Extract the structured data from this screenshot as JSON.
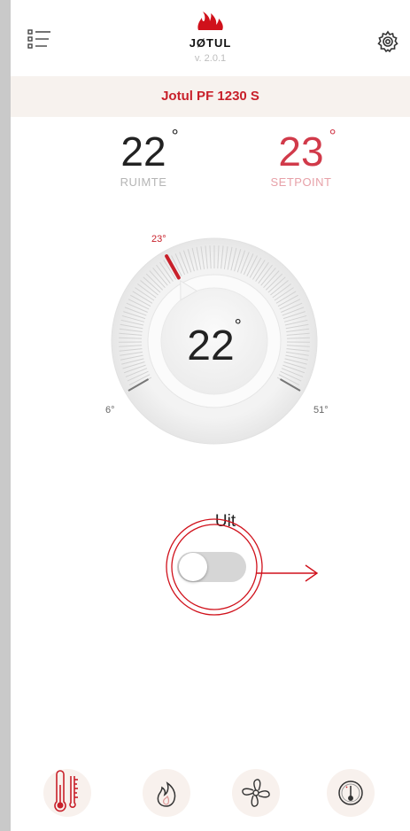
{
  "header": {
    "brand": "JØTUL",
    "version": "v. 2.0.1",
    "menu_icon": "list-menu-icon",
    "settings_icon": "gear-icon"
  },
  "device": {
    "name": "Jotul PF 1230 S"
  },
  "temperatures": {
    "room": {
      "value": "22",
      "label": "RUIMTE"
    },
    "setpoint": {
      "value": "23",
      "label": "SETPOINT"
    }
  },
  "dial": {
    "current": "22",
    "setpoint_marker": "23°",
    "min_label": "6°",
    "max_label": "51°",
    "min": 6,
    "max": 51,
    "setpoint": 23
  },
  "mode": {
    "label": "Uit",
    "toggle_on": false
  },
  "bottom_nav": [
    {
      "icon": "thermometer-icon",
      "active": true
    },
    {
      "icon": "flame-icon",
      "active": false
    },
    {
      "icon": "fan-icon",
      "active": false
    },
    {
      "icon": "gauge-icon",
      "active": false
    }
  ],
  "colors": {
    "accent": "#c8202a",
    "setpoint": "#d13a4a",
    "nav_bg": "#f8f1ed",
    "device_bar_bg": "#f7f2ee"
  }
}
